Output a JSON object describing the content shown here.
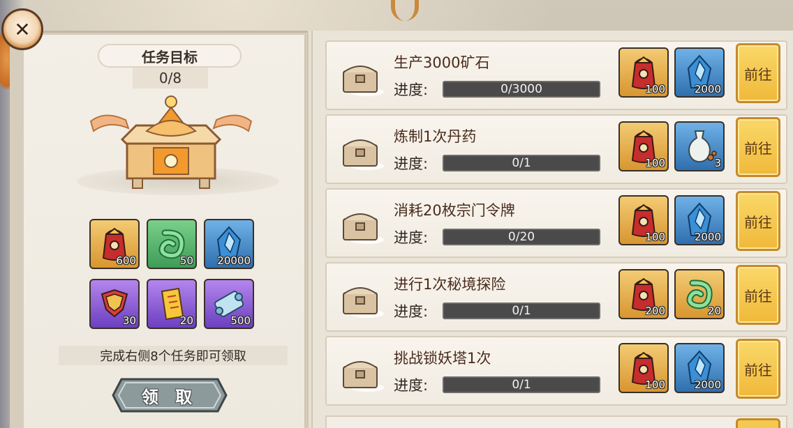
{
  "panel": {
    "title": "任务目标",
    "progress": "0/8",
    "rewards": [
      {
        "icon": "red-treasure-bag-icon",
        "qty": "600",
        "bg": "gold"
      },
      {
        "icon": "jade-pendant-icon",
        "qty": "50",
        "bg": "green"
      },
      {
        "icon": "spirit-crystal-icon",
        "qty": "20000",
        "bg": "blue"
      },
      {
        "icon": "purple-armor-icon",
        "qty": "30",
        "bg": "purple"
      },
      {
        "icon": "gold-talisman-icon",
        "qty": "20",
        "bg": "purple"
      },
      {
        "icon": "scroll-icon",
        "qty": "500",
        "bg": "purple"
      }
    ],
    "hint": "完成右侧8个任务即可领取",
    "claim_label": "领 取"
  },
  "tasks": [
    {
      "title": "生产3000矿石",
      "progress_label": "进度:",
      "progress_text": "0/3000",
      "progress_fraction": 0,
      "rewards": [
        {
          "icon": "red-treasure-bag-icon",
          "qty": "100",
          "bg": "gold"
        },
        {
          "icon": "spirit-crystal-icon",
          "qty": "2000",
          "bg": "blue"
        }
      ],
      "go_label": "前往"
    },
    {
      "title": "炼制1次丹药",
      "progress_label": "进度:",
      "progress_text": "0/1",
      "progress_fraction": 0,
      "rewards": [
        {
          "icon": "red-treasure-bag-icon",
          "qty": "100",
          "bg": "gold"
        },
        {
          "icon": "porcelain-vase-icon",
          "qty": "3",
          "bg": "blue"
        }
      ],
      "go_label": "前往"
    },
    {
      "title": "消耗20枚宗门令牌",
      "progress_label": "进度:",
      "progress_text": "0/20",
      "progress_fraction": 0,
      "rewards": [
        {
          "icon": "red-treasure-bag-icon",
          "qty": "100",
          "bg": "gold"
        },
        {
          "icon": "spirit-crystal-icon",
          "qty": "2000",
          "bg": "blue"
        }
      ],
      "go_label": "前往"
    },
    {
      "title": "进行1次秘境探险",
      "progress_label": "进度:",
      "progress_text": "0/1",
      "progress_fraction": 0,
      "rewards": [
        {
          "icon": "red-treasure-bag-icon",
          "qty": "200",
          "bg": "gold"
        },
        {
          "icon": "jade-pendant-icon",
          "qty": "20",
          "bg": "gold"
        }
      ],
      "go_label": "前往"
    },
    {
      "title": "挑战锁妖塔1次",
      "progress_label": "进度:",
      "progress_text": "0/1",
      "progress_fraction": 0,
      "rewards": [
        {
          "icon": "red-treasure-bag-icon",
          "qty": "100",
          "bg": "gold"
        },
        {
          "icon": "spirit-crystal-icon",
          "qty": "2000",
          "bg": "blue"
        }
      ],
      "go_label": "前往"
    }
  ]
}
